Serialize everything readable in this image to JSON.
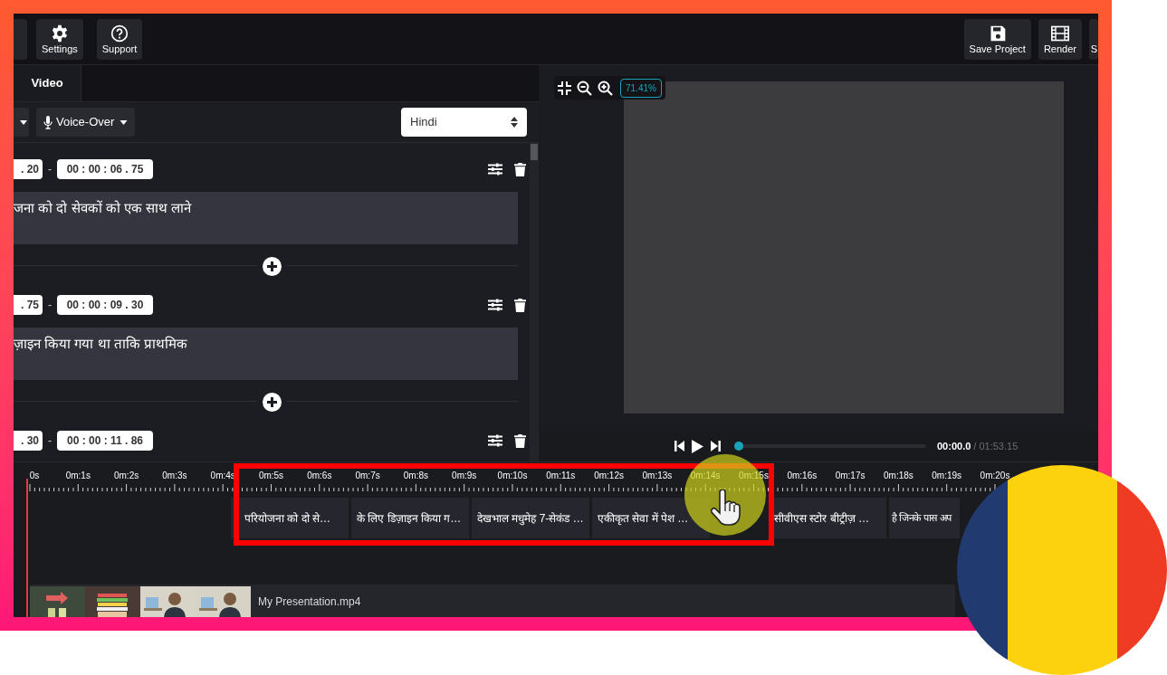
{
  "toolbar": {
    "left_buttons": [
      {
        "label": "Settings",
        "kind": "gear"
      },
      {
        "label": "Support",
        "kind": "help"
      }
    ],
    "right_buttons": [
      {
        "label": "Save Project",
        "kind": "save"
      },
      {
        "label": "Render",
        "kind": "film"
      },
      {
        "label": "S",
        "kind": "none"
      }
    ]
  },
  "tabs": [
    {
      "label": "Video",
      "selected": true
    }
  ],
  "subtitle_toolbar": {
    "voice_over": "Voice-Over",
    "language": "Hindi"
  },
  "subtitles": [
    {
      "start": ". 20",
      "separator": "-",
      "end": "00 : 00 : 06 . 75",
      "text": "जना को दो सेवकों को एक साथ लाने"
    },
    {
      "start": ". 75",
      "separator": "-",
      "end": "00 : 00 : 09 . 30",
      "text": "ज़ाइन किया गया था ताकि प्राथमिक"
    },
    {
      "start": ". 30",
      "separator": "-",
      "end": "00 : 00 : 11 . 86"
    }
  ],
  "preview": {
    "zoom": "71.41%",
    "current_time": "00:00.0",
    "duration": "/ 01:53.15",
    "level": 0
  },
  "timeline": {
    "ticks": [
      "0s",
      "0m:1s",
      "0m:2s",
      "0m:3s",
      "0m:4s",
      "0m:5s",
      "0m:6s",
      "0m:7s",
      "0m:8s",
      "0m:9s",
      "0m:10s",
      "0m:11s",
      "0m:12s",
      "0m:13s",
      "0m:14s",
      "0m:15s",
      "0m:16s",
      "0m:17s",
      "0m:18s",
      "0m:19s",
      "0m:20s"
    ],
    "clips": [
      {
        "text": "परियोजना को दो से…"
      },
      {
        "text": "के लिए डिज़ाइन किया ग…"
      },
      {
        "text": "देखभाल मधुमेह 7-सेकंड …"
      },
      {
        "text": "एकीकृत सेवा में पेश …"
      },
      {
        "text": "सीवीएस स्टोर बीट्रीज़ …",
        "follows_hidden_clip": true
      },
      {
        "text": "है जिनके पास अप"
      }
    ],
    "video_track": {
      "name": "My Presentation.mp4"
    }
  }
}
